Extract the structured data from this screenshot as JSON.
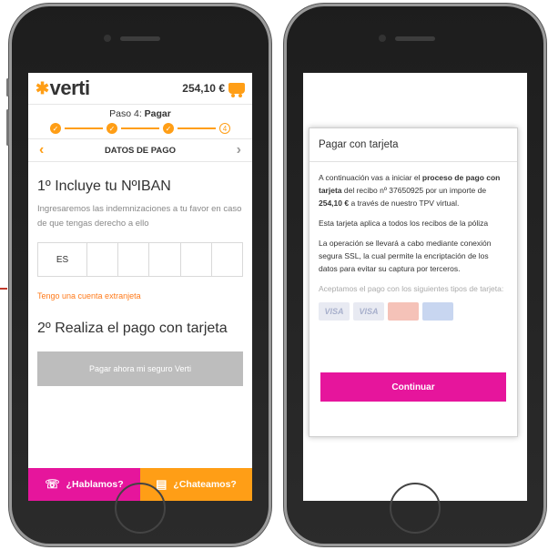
{
  "colors": {
    "brand_orange": "#ff9e16",
    "brand_magenta": "#e6159c",
    "disabled_grey": "#bdbdbd"
  },
  "left": {
    "header": {
      "logo_prefix": "✱",
      "logo_text": "verti",
      "cart_total": "254,10 €",
      "cart_icon": "cart-icon"
    },
    "stepper": {
      "label_prefix": "Paso 4:",
      "label_step": "Pagar",
      "steps": [
        "✓",
        "✓",
        "✓",
        "4"
      ]
    },
    "pager": {
      "prev_icon": "‹",
      "title": "DATOS DE PAGO",
      "next_icon": "›"
    },
    "iban_section": {
      "title": "1º Incluye tu NºIBAN",
      "description": "Ingresaremos las indemnizaciones a tu favor en caso de que tengas derecho a ello",
      "country_code": "ES",
      "foreign_account_link": "Tengo una cuenta extranjeta"
    },
    "payment_section": {
      "title": "2º Realiza el pago con tarjeta",
      "pay_button": "Pagar ahora mi seguro Verti"
    },
    "footer": {
      "call_label": "¿Hablamos?",
      "call_icon": "phone-icon",
      "chat_label": "¿Chateamos?",
      "chat_icon": "chat-icon"
    }
  },
  "right": {
    "modal": {
      "title": "Pagar con tarjeta",
      "p1_a": "A continuación vas a iniciar el ",
      "p1_b": "proceso de pago con tarjeta",
      "p1_c": " del recibo nº 37650925 por un importe de ",
      "p1_d": "254,10 €",
      "p1_e": " a través de nuestro TPV virtual.",
      "p2": "Esta tarjeta aplica a todos los recibos de la póliza",
      "p3": "La operación se llevará a cabo mediante conexión segura SSL, la cual permite la encriptación de los datos para evitar su captura por terceros.",
      "p4": "Aceptamos el pago con los siguientes tipos de tarjeta:",
      "cards": [
        "VISA",
        "VISA",
        "",
        ""
      ],
      "continue_button": "Continuar"
    }
  }
}
